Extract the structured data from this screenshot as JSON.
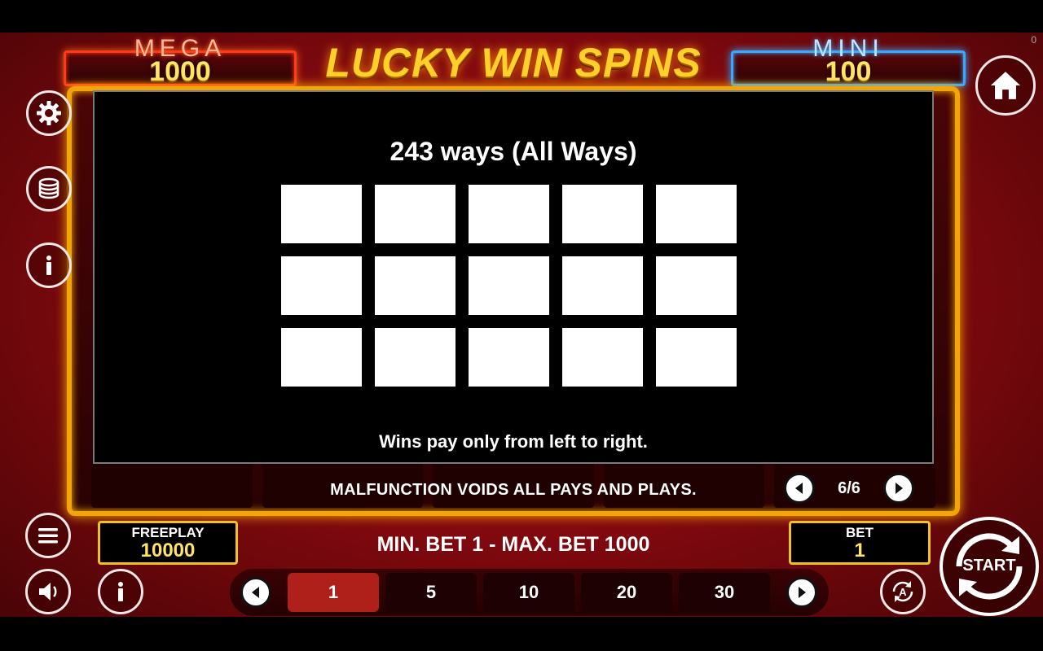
{
  "status_counter": "0",
  "game_title": "LUCKY WIN SPINS",
  "jackpots": {
    "mega": {
      "label": "MEGA",
      "value": "1000"
    },
    "mini": {
      "label": "MINI",
      "value": "100"
    }
  },
  "info_page": {
    "title": "243 ways (All Ways)",
    "grid_rows": 3,
    "grid_cols": 5,
    "note": "Wins pay only from left to right.",
    "page_indicator": "6/6"
  },
  "disclaimer": "MALFUNCTION VOIDS ALL PAYS AND PLAYS.",
  "freeplay": {
    "label": "FREEPLAY",
    "value": "10000"
  },
  "bet": {
    "label": "BET",
    "value": "1"
  },
  "bet_limits": "MIN. BET 1 - MAX. BET 1000",
  "bet_options": [
    "1",
    "5",
    "10",
    "20",
    "30"
  ],
  "selected_bet_option": "1",
  "start_label": "START",
  "icons": {
    "settings": "gear-icon",
    "coins": "coin-stack-icon",
    "info": "info-icon",
    "menu": "menu-icon",
    "sound": "speaker-icon",
    "home": "home-icon",
    "autoplay": "autoplay-icon"
  },
  "colors": {
    "accent_gold": "#f2c21a",
    "mega_red": "#ff3a1a",
    "mini_blue": "#3aa8ff",
    "active_bet": "#b0201a"
  }
}
